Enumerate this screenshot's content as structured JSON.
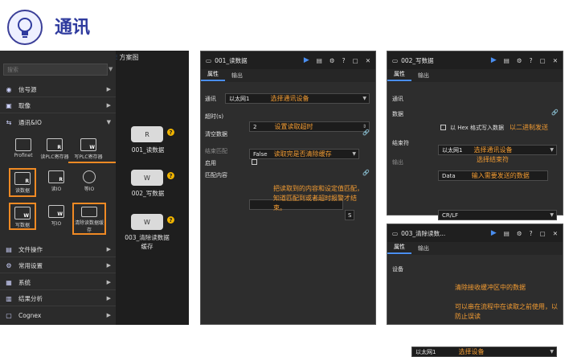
{
  "header": {
    "title": "通讯"
  },
  "sidebar": {
    "search_placeholder": "搜索",
    "categories": [
      {
        "label": "信号源",
        "icon": "signal-icon"
      },
      {
        "label": "取像",
        "icon": "image-icon"
      },
      {
        "label": "通讯&IO",
        "icon": "link-icon"
      }
    ],
    "tools": [
      {
        "label": "Profinet",
        "icon": "profinet-icon"
      },
      {
        "label": "读PLC寄存器",
        "icon": "read-plc-icon"
      },
      {
        "label": "写PLC寄存器",
        "icon": "write-plc-icon"
      },
      {
        "label": "读数据",
        "icon": "read-data-icon"
      },
      {
        "label": "读IO",
        "icon": "read-io-icon"
      },
      {
        "label": "等IO",
        "icon": "wait-io-icon"
      },
      {
        "label": "写数据",
        "icon": "write-data-icon"
      },
      {
        "label": "写IO",
        "icon": "write-io-icon"
      },
      {
        "label": "清除读数据缓存",
        "icon": "clear-cache-icon"
      }
    ],
    "more_categories": [
      {
        "label": "文件操作",
        "icon": "file-icon"
      },
      {
        "label": "常用设置",
        "icon": "settings-icon"
      },
      {
        "label": "系统",
        "icon": "system-icon"
      },
      {
        "label": "结果分析",
        "icon": "chart-icon"
      },
      {
        "label": "Cognex",
        "icon": "cognex-icon"
      }
    ]
  },
  "canvas": {
    "tab_label": "方案图",
    "nodes": [
      {
        "label": "001_读数据",
        "icon": "R"
      },
      {
        "label": "002_写数据",
        "icon": "W"
      },
      {
        "label": "003_清除读数据缓存",
        "icon": "W"
      }
    ]
  },
  "dialog_read": {
    "title": "001_读数据",
    "tabs": [
      "属性",
      "输出"
    ],
    "comm_label": "通讯",
    "comm_value": "以太网1",
    "comm_note": "选择通讯设备",
    "timeout_label": "超时(s)",
    "timeout_value": "2",
    "timeout_note": "设置读取超时",
    "clear_label": "清空数据",
    "clear_value": "False",
    "clear_note": "读取完是否清除缓存",
    "section_title": "结束匹配",
    "enable_label": "启用",
    "match_label": "匹配内容",
    "match_btn": "S",
    "explanation": "把读取到的内容和设定值匹配，知道匹配到或者超时报警才结束。"
  },
  "dialog_write": {
    "title": "002_写数据",
    "tabs": [
      "属性",
      "输出"
    ],
    "comm_label": "通讯",
    "comm_value": "以太网1",
    "comm_note": "选择通讯设备",
    "data_label": "数据",
    "data_value": "Data",
    "data_note": "输入需要发送的数据",
    "hex_label": "以 Hex 格式写入数据",
    "hex_note": "以二进制发送",
    "end_label": "结束符",
    "end_value": "CR/LF",
    "section_title": "输出",
    "end_note": "选择结束符"
  },
  "dialog_clear": {
    "title": "003_清除读数...",
    "tabs": [
      "属性",
      "输出"
    ],
    "device_label": "设备",
    "device_value": "以太网1",
    "device_note": "选择设备",
    "note1": "清除接收缓冲区中的数据",
    "note2": "可以串在流程中在读取之前使用，以防止误读"
  }
}
